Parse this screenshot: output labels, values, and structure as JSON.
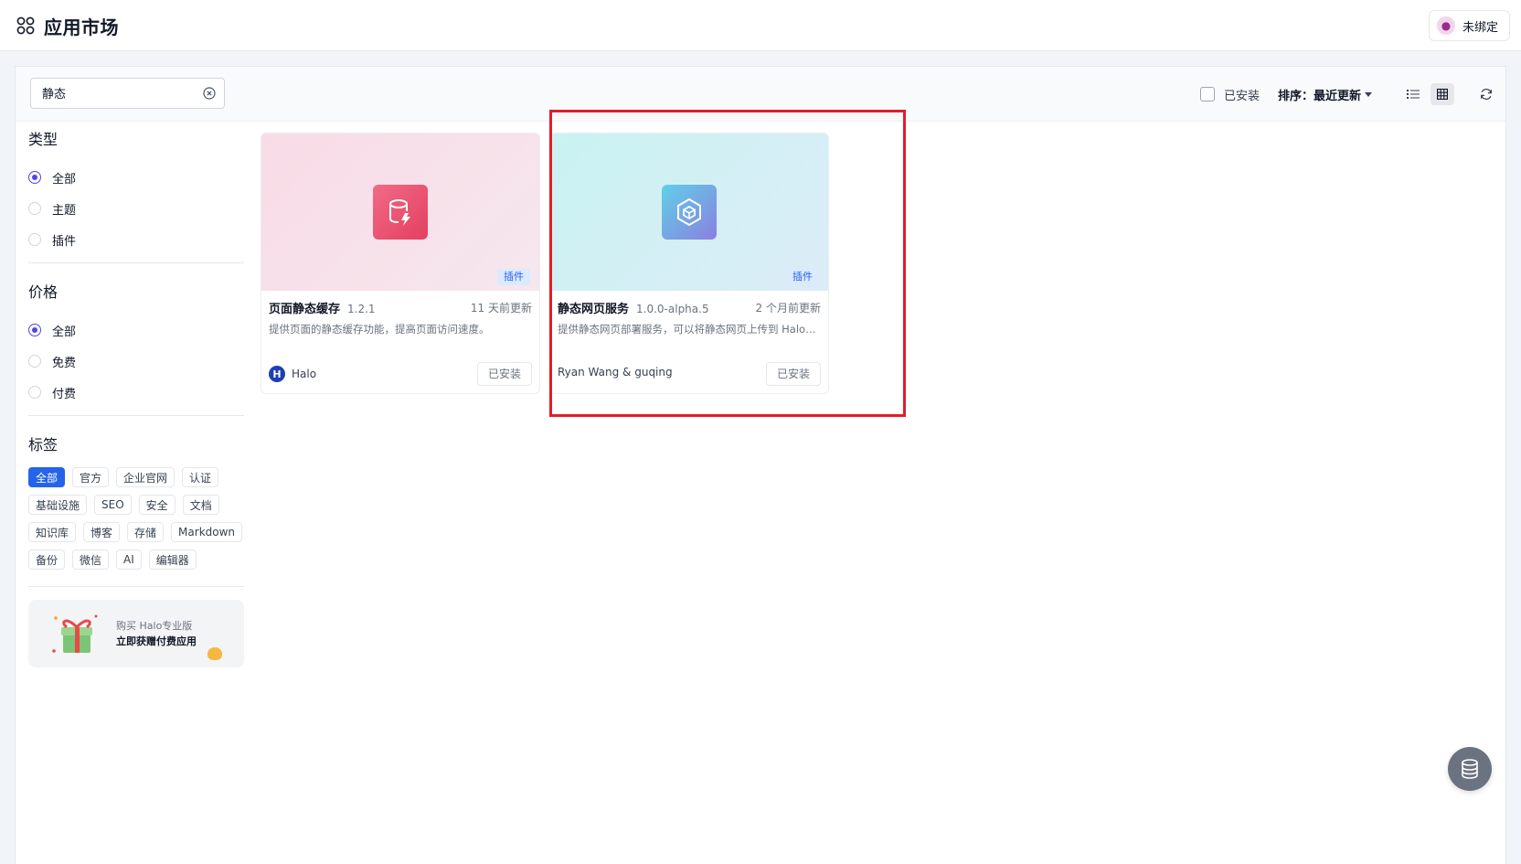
{
  "header": {
    "title": "应用市场",
    "bind_label": "未绑定"
  },
  "toolbar": {
    "search_value": "静态",
    "installed_label": "已安装",
    "sort_label": "排序：",
    "sort_value": "最近更新"
  },
  "filters": {
    "type": {
      "title": "类型",
      "options": [
        "全部",
        "主题",
        "插件"
      ],
      "selected": "全部"
    },
    "price": {
      "title": "价格",
      "options": [
        "全部",
        "免费",
        "付费"
      ],
      "selected": "全部"
    },
    "tags": {
      "title": "标签",
      "items": [
        "全部",
        "官方",
        "企业官网",
        "认证",
        "基础设施",
        "SEO",
        "安全",
        "文档",
        "知识库",
        "博客",
        "存储",
        "Markdown",
        "备份",
        "微信",
        "AI",
        "编辑器"
      ],
      "selected": "全部"
    }
  },
  "promo": {
    "line1": "购买 Halo专业版",
    "line2": "立即获赠付费应用"
  },
  "apps": [
    {
      "name": "页面静态缓存",
      "version": "1.2.1",
      "updated": "11 天前更新",
      "description": "提供页面的静态缓存功能，提高页面访问速度。",
      "author": "Halo",
      "author_initial": "H",
      "kind": "插件",
      "action": "已安装"
    },
    {
      "name": "静态网页服务",
      "version": "1.0.0-alpha.5",
      "updated": "2 个月前更新",
      "description": "提供静态网页部署服务，可以将静态网页上传到 Halo，…",
      "author": "Ryan Wang & guqing",
      "kind": "插件",
      "action": "已安装"
    }
  ],
  "colors": {
    "accent": "#2563eb",
    "radio": "#4f46e5",
    "highlight": "#e11d2a"
  }
}
